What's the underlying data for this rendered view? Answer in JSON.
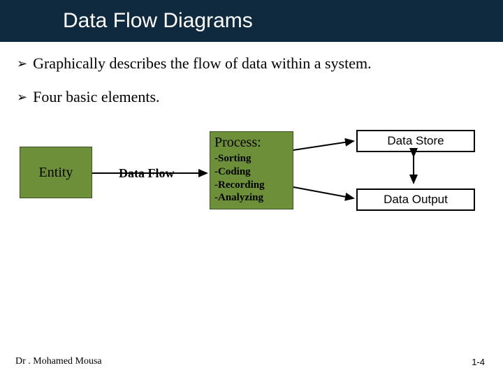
{
  "title": "Data Flow Diagrams",
  "bullets": [
    "Graphically describes the flow of data within a system.",
    "Four basic elements."
  ],
  "diagram": {
    "entity_label": "Entity",
    "dataflow_label": "Data Flow",
    "process": {
      "title": "Process:",
      "items": [
        "-Sorting",
        "-Coding",
        "-Recording",
        "-Analyzing"
      ]
    },
    "data_store_label": "Data Store",
    "data_output_label": "Data Output"
  },
  "footer": {
    "author": "Dr . Mohamed Mousa",
    "page": "1-4"
  }
}
